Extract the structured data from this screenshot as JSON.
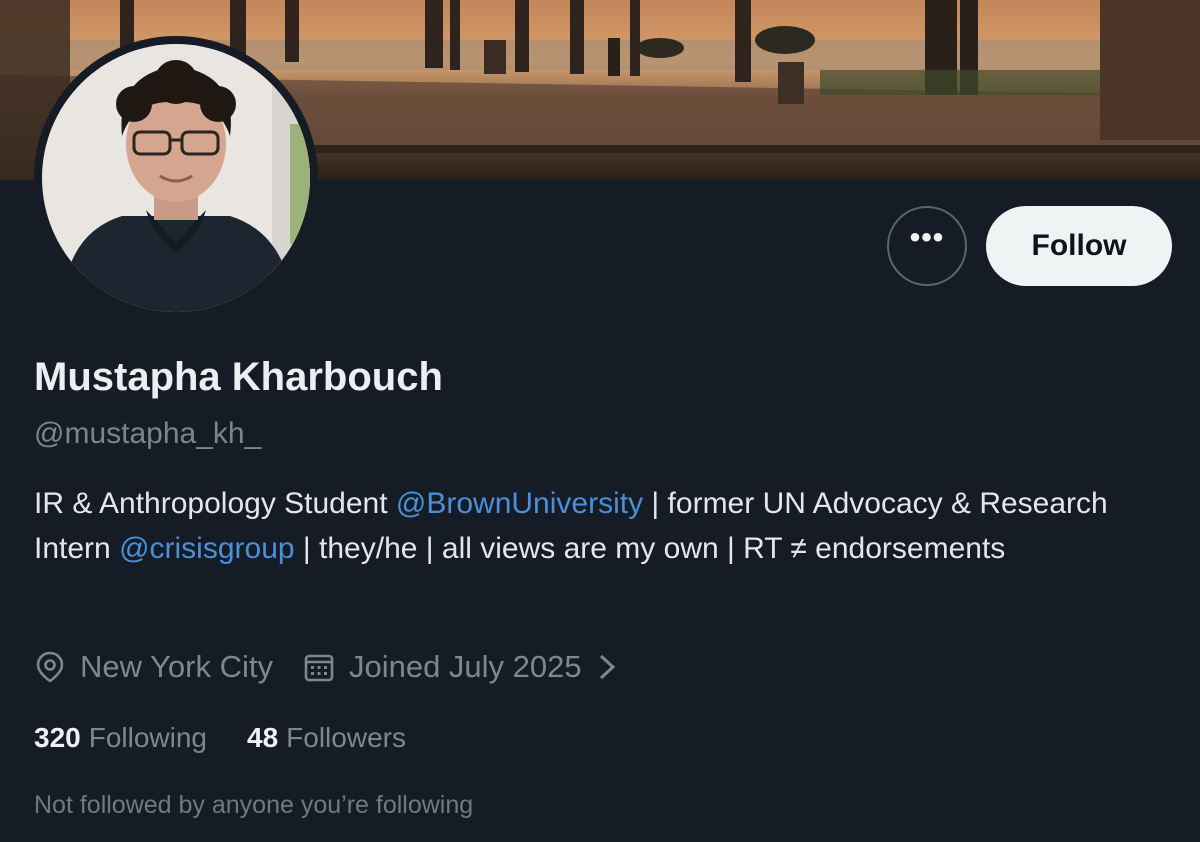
{
  "profile": {
    "display_name": "Mustapha Kharbouch",
    "handle": "@mustapha_kh_",
    "bio": {
      "part1": "IR & Anthropology Student ",
      "mention1": "@BrownUniversity",
      "part2": " | former UN Advocacy & Research Intern ",
      "mention2": "@crisisgroup",
      "part3": " | they/he | all views are my own | RT ≠ endorsements"
    },
    "location": "New York City",
    "joined": "Joined July 2025",
    "following_count": "320",
    "following_label": "Following",
    "followers_count": "48",
    "followers_label": "Followers",
    "not_followed_text": "Not followed by anyone you’re following"
  },
  "actions": {
    "more_label": "•••",
    "follow_label": "Follow"
  },
  "icons": {
    "location": "location-pin-icon",
    "calendar": "calendar-icon",
    "chevron": "chevron-right-icon"
  },
  "colors": {
    "background": "#151c26",
    "mention": "#4a8fd8",
    "follow_button_bg": "#eff3f4",
    "secondary_text": "#7d8792"
  }
}
